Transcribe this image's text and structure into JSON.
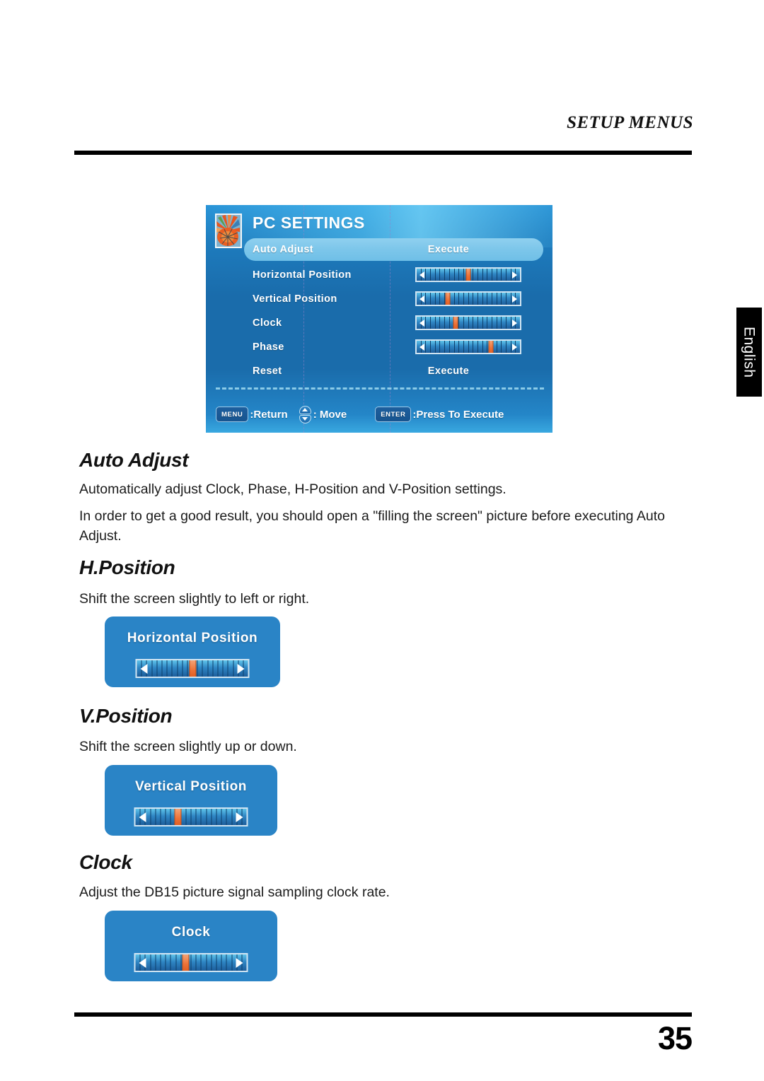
{
  "page": {
    "header": "SETUP MENUS",
    "number": "35",
    "language_tab": "English"
  },
  "osd": {
    "title": "PC SETTINGS",
    "thumbnail_icon": "flower-thumbnail-icon",
    "rows": [
      {
        "label": "Auto Adjust",
        "value": "Execute",
        "control": "value",
        "highlighted": true
      },
      {
        "label": "Horizontal Position",
        "value": "",
        "control": "slider",
        "position": 50
      },
      {
        "label": "Vertical Position",
        "value": "",
        "control": "slider",
        "position": 30
      },
      {
        "label": "Clock",
        "value": "",
        "control": "slider",
        "position": 38
      },
      {
        "label": "Phase",
        "value": "",
        "control": "slider",
        "position": 72
      },
      {
        "label": "Reset",
        "value": "Execute",
        "control": "value",
        "highlighted": false
      }
    ],
    "footer": {
      "menu_key": "MENU",
      "menu_action": ":Return",
      "move_icon": "up-down-arrows-icon",
      "move_action": ": Move",
      "enter_key": "ENTER",
      "enter_action": ":Press To Execute"
    }
  },
  "sections": [
    {
      "title": "Auto Adjust",
      "paragraphs": [
        "Automatically adjust Clock, Phase, H-Position and V-Position settings.",
        "In order to get a good result, you should open a \"filling the screen\" picture before executing Auto Adjust."
      ]
    },
    {
      "title": "H.Position",
      "paragraphs": [
        "Shift the screen slightly to left or right."
      ],
      "card": {
        "label": "Horizontal Position",
        "position": 50
      }
    },
    {
      "title": "V.Position",
      "paragraphs": [
        "Shift the screen slightly up or down."
      ],
      "card": {
        "label": "Vertical Position",
        "position": 38
      }
    },
    {
      "title": "Clock",
      "paragraphs": [
        "Adjust the DB15 picture signal sampling clock rate."
      ],
      "card": {
        "label": "Clock",
        "position": 45
      }
    }
  ],
  "colors": {
    "osd_blue": "#1a6cab",
    "card_blue": "#2a84c6",
    "highlight_blue": "#7cc6ea",
    "thumb_orange": "#ec7136"
  }
}
